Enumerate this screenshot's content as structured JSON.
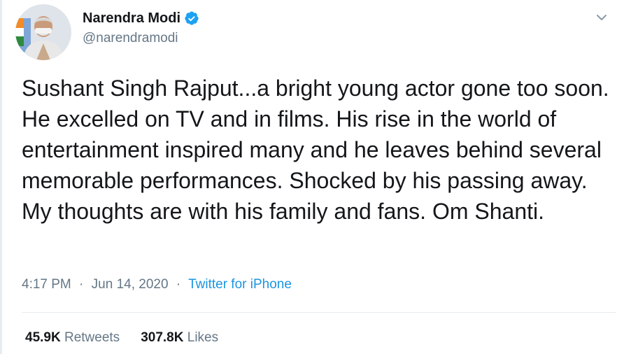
{
  "tweet": {
    "author": {
      "display_name": "Narendra Modi",
      "handle": "@narendramodi",
      "verified_icon": "verified-badge-icon",
      "avatar_icon": "avatar"
    },
    "menu_icon": "chevron-down-icon",
    "text": "Sushant Singh Rajput...a bright young actor gone too soon. He excelled on TV and in films. His rise in the world of entertainment inspired many and he leaves behind several memorable performances. Shocked by his passing away. My thoughts are with his family and fans. Om Shanti.",
    "time": "4:17 PM",
    "separator": "·",
    "date": "Jun 14, 2020",
    "source": "Twitter for iPhone",
    "stats": {
      "retweets_count": "45.9K",
      "retweets_label": "Retweets",
      "likes_count": "307.8K",
      "likes_label": "Likes"
    }
  },
  "colors": {
    "text": "#14171a",
    "secondary": "#657786",
    "link": "#1b95e0",
    "verified": "#1da1f2",
    "divider": "#e6ecf0"
  }
}
